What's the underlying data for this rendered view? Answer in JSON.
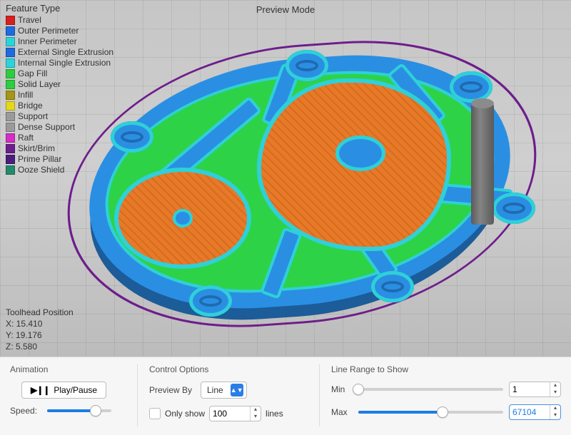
{
  "title": "Preview Mode",
  "legend": {
    "header": "Feature Type",
    "items": [
      {
        "label": "Travel",
        "color": "#d81f1f"
      },
      {
        "label": "Outer Perimeter",
        "color": "#1e6adf"
      },
      {
        "label": "Inner Perimeter",
        "color": "#2bd3da"
      },
      {
        "label": "External Single Extrusion",
        "color": "#1e6adf"
      },
      {
        "label": "Internal Single Extrusion",
        "color": "#2bd3da"
      },
      {
        "label": "Gap Fill",
        "color": "#2ecc40"
      },
      {
        "label": "Solid Layer",
        "color": "#2ecc40"
      },
      {
        "label": "Infill",
        "color": "#a39618"
      },
      {
        "label": "Bridge",
        "color": "#e6d61d"
      },
      {
        "label": "Support",
        "color": "#9a9a9a"
      },
      {
        "label": "Dense Support",
        "color": "#9a9a9a"
      },
      {
        "label": "Raft",
        "color": "#d52dc5"
      },
      {
        "label": "Skirt/Brim",
        "color": "#6d1d8c"
      },
      {
        "label": "Prime Pillar",
        "color": "#4a1e7a"
      },
      {
        "label": "Ooze Shield",
        "color": "#238a6c"
      }
    ]
  },
  "toolhead": {
    "header": "Toolhead Position",
    "x": "X: 15.410",
    "y": "Y: 19.176",
    "z": "Z: 5.580"
  },
  "panel": {
    "animation": {
      "title": "Animation",
      "play_label": "Play/Pause",
      "speed_label": "Speed:",
      "speed_percent": 76
    },
    "options": {
      "title": "Control Options",
      "preview_by_label": "Preview By",
      "preview_by_value": "Line",
      "only_show_label": "Only show",
      "only_show_value": "100",
      "only_show_suffix": "lines",
      "only_show_checked": false
    },
    "range": {
      "title": "Line Range to Show",
      "min_label": "Min",
      "max_label": "Max",
      "min_value": "1",
      "max_value": "67104",
      "min_percent": 0,
      "max_percent": 58
    }
  }
}
